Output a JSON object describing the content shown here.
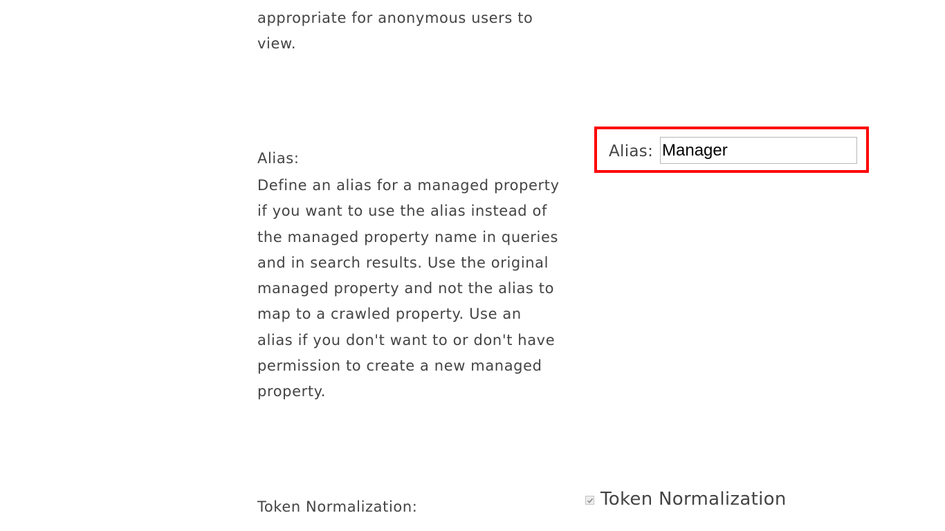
{
  "intro": {
    "text_lines": [
      "appropriate for anonymous users to",
      "view."
    ]
  },
  "alias_section": {
    "title": "Alias:",
    "description": "Define an alias for a managed property if you want to use the alias instead of the managed property name in queries and in search results. Use the original managed property and not the alias to map to a crawled property. Use an alias if you don't want to or don't have permission to create a new managed property.",
    "field_label": "Alias:",
    "field_value": "Manager",
    "highlight_color": "#ff0000"
  },
  "token_section": {
    "title": "Token Normalization:",
    "checkbox_label": "Token Normalization",
    "checkbox_checked": true,
    "checkbox_disabled": true
  }
}
